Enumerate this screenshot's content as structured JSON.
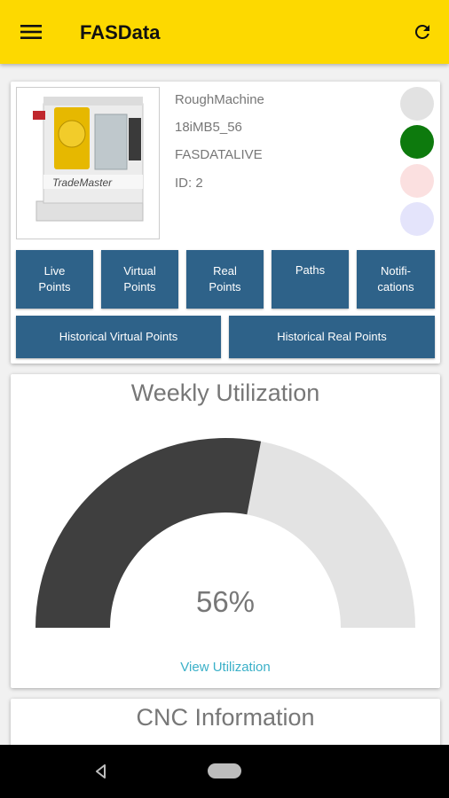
{
  "app": {
    "title": "FASData"
  },
  "icons": {
    "menu": "hamburger-menu-icon",
    "refresh": "refresh-icon",
    "back": "nav-back-icon",
    "home": "nav-home-icon"
  },
  "colors": {
    "appbar": "#fdd900",
    "button": "#2e6289",
    "link": "#3ab0c8",
    "gauge_filled": "#3f3f3f",
    "gauge_empty": "#e3e3e3"
  },
  "machine": {
    "name": "RoughMachine",
    "model": "18iMB5_56",
    "source": "FASDATALIVE",
    "id": "ID: 2",
    "status_dots": [
      "#e2e2e2",
      "#0d7a0d",
      "#fbe0e0",
      "#e4e4fb"
    ],
    "image_brand": "TradeMaster"
  },
  "buttons": {
    "live_points": "Live\nPoints",
    "virtual_points": "Virtual\nPoints",
    "real_points": "Real\nPoints",
    "paths": "Paths",
    "notifications": "Notifi-\ncations",
    "historical_virtual": "Historical Virtual Points",
    "historical_real": "Historical Real Points"
  },
  "utilization": {
    "title": "Weekly Utilization",
    "value": 0.56,
    "value_text": "56%",
    "link": "View Utilization"
  },
  "cnc": {
    "title": "CNC Information"
  }
}
